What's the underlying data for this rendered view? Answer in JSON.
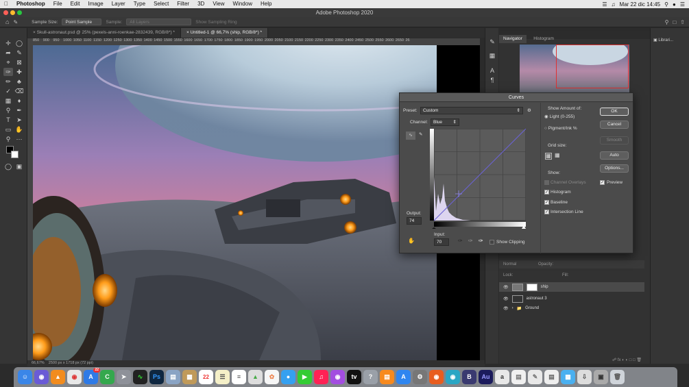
{
  "menubar": {
    "apple": "",
    "app": "Photoshop",
    "items": [
      "File",
      "Edit",
      "Image",
      "Layer",
      "Type",
      "Select",
      "Filter",
      "3D",
      "View",
      "Window",
      "Help"
    ],
    "datetime": "Mar 22 dic  14:45"
  },
  "window": {
    "title": "Adobe Photoshop 2020"
  },
  "options": {
    "sample_size_label": "Sample Size:",
    "sample_size_value": "Point Sample",
    "sample_label": "Sample:",
    "sample_value": "All Layers",
    "sampling_ring": "Show Sampling Ring"
  },
  "tabs": [
    {
      "label": "Skull-astronaut.psd @ 25% (pexels-anni-roenkae-2832439, RGB/8*) *"
    },
    {
      "label": "Untitled-1 @ 66,7% (ship, RGB/8*) *"
    }
  ],
  "ruler": [
    "850",
    "900",
    "950",
    "1000",
    "1050",
    "1100",
    "1150",
    "1200",
    "1250",
    "1300",
    "1350",
    "1400",
    "1450",
    "1500",
    "1550",
    "1600",
    "1650",
    "1700",
    "1750",
    "1800",
    "1850",
    "1900",
    "1950",
    "2000",
    "2050",
    "2100",
    "2150",
    "2200",
    "2250",
    "2300",
    "2350",
    "2400",
    "2450",
    "2500",
    "2550",
    "2600",
    "2650",
    "26"
  ],
  "status": {
    "zoom": "66,67%",
    "doc": "2500 px x 1718 px (72 ppi)"
  },
  "panels": {
    "navigator": "Navigator",
    "histogram": "Histogram",
    "libraries": "Librari...",
    "blend_mode": "Normal",
    "opacity_label": "Opacity:",
    "lock_label": "Lock:",
    "fill_label": "Fill:",
    "layers": [
      {
        "name": "ship",
        "selected": true
      },
      {
        "name": "astronaut 3",
        "selected": false
      },
      {
        "name": "Ground",
        "selected": false
      }
    ]
  },
  "curves": {
    "title": "Curves",
    "preset_label": "Preset:",
    "preset_value": "Custom",
    "channel_label": "Channel:",
    "channel_value": "Blue",
    "output_label": "Output:",
    "output_value": "74",
    "input_label": "Input:",
    "input_value": "70",
    "show_clipping": "Show Clipping",
    "show_amount_label": "Show Amount of:",
    "light": "Light  (0-255)",
    "pigment": "Pigment/Ink %",
    "grid_size_label": "Grid size:",
    "show_label": "Show:",
    "channel_overlays": "Channel Overlays",
    "histogram": "Histogram",
    "baseline": "Baseline",
    "intersection_line": "Intersection Line",
    "ok": "OK",
    "cancel": "Cancel",
    "smooth": "Smooth",
    "auto": "Auto",
    "options": "Options...",
    "preview": "Preview",
    "accent": "#6b62d8"
  },
  "dock": {
    "badge_count": "22",
    "calendar_day": "22"
  }
}
